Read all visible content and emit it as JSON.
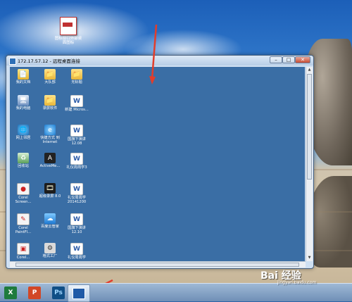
{
  "desktop": {
    "icon_label": "图标窗口外部桌面图标"
  },
  "window": {
    "title": "172.17.57.12 - 远程桌面连接",
    "min_glyph": "–",
    "max_glyph": "□",
    "close_glyph": "✕"
  },
  "remote_icons": [
    {
      "label": "我的文档",
      "glyph": "📄"
    },
    {
      "label": "大队部",
      "glyph": "📁"
    },
    {
      "label": "无标题",
      "glyph": "📁"
    },
    {
      "label": "我的电脑",
      "glyph": "🖥"
    },
    {
      "label": "录屏软件",
      "glyph": "📁"
    },
    {
      "label": "新建 Micros...",
      "glyph": "W"
    },
    {
      "label": "网上邻居",
      "glyph": "🌐"
    },
    {
      "label": "快捷方式 到 Internet",
      "glyph": "e"
    },
    {
      "label": "国旗下演讲 12.08",
      "glyph": "W"
    },
    {
      "label": "回收站",
      "glyph": "♻"
    },
    {
      "label": "ActiveMe...",
      "glyph": "A"
    },
    {
      "label": "礼仪周周学3",
      "glyph": "W"
    },
    {
      "label": "Corel Screen...",
      "glyph": "●"
    },
    {
      "label": "超级录屏 8.0",
      "glyph": "🎞"
    },
    {
      "label": "礼仪周周学 20141200",
      "glyph": "W"
    },
    {
      "label": "Corel PaintFl...",
      "glyph": "✎"
    },
    {
      "label": "百度云管家",
      "glyph": "☁"
    },
    {
      "label": "国旗下演讲 12.10",
      "glyph": "W"
    },
    {
      "label": "Corel...",
      "glyph": "▣"
    },
    {
      "label": "格式工厂",
      "glyph": "⚙"
    },
    {
      "label": "礼仪周周学",
      "glyph": "W"
    }
  ],
  "taskbar": {
    "excel": "X",
    "ppt": "P",
    "ps": "Ps"
  },
  "watermark": {
    "main": "Bai 经验",
    "sub": "jingyan.baidu.com"
  },
  "colors": {
    "remote_bg": "#3a6ea5",
    "arrow": "#e23d2b"
  }
}
